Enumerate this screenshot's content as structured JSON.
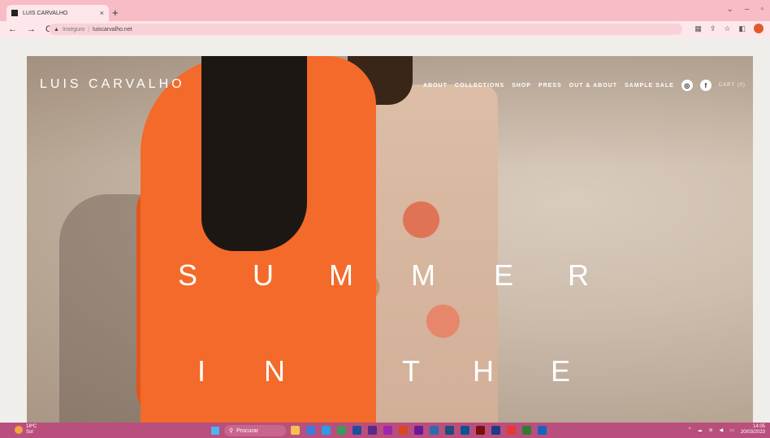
{
  "browser": {
    "tab_title": "LUIS CARVALHO",
    "tab_close": "×",
    "new_tab": "+",
    "window_controls": [
      "⌄",
      "–",
      "▫"
    ],
    "nav": {
      "back": "←",
      "forward": "→",
      "reload": "C"
    },
    "insecure_label": "Inseguro",
    "url": "luiscarvalho.net"
  },
  "site": {
    "logo": "LUIS CARVALHO",
    "nav": [
      "ABOUT",
      "COLLECTIONS",
      "SHOP",
      "PRESS",
      "OUT & ABOUT",
      "SAMPLE SALE"
    ],
    "social": {
      "instagram_glyph": "◎",
      "facebook_glyph": "f"
    },
    "cart": "CART (0)"
  },
  "hero": {
    "line1": [
      "S",
      "U",
      "M",
      "M",
      "E",
      "R"
    ],
    "line2": [
      "I",
      "N",
      "T",
      "H",
      "E"
    ]
  },
  "taskbar": {
    "weather_temp": "18ºC",
    "weather_cond": "Sol",
    "search_label": "Procurar",
    "time": "14:05",
    "date": "20/03/2023",
    "app_colors": [
      "#f2c14e",
      "#3d7bd9",
      "#2f9be6",
      "#3c9a5f",
      "#1e4fa0",
      "#5b2a86",
      "#9c27b0",
      "#d9481e",
      "#6a1b9a",
      "#2b6cb0",
      "#1f4e79",
      "#0b5394",
      "#7a0f0f",
      "#1e3a8a",
      "#e53935",
      "#2e7d32",
      "#1565c0"
    ]
  }
}
